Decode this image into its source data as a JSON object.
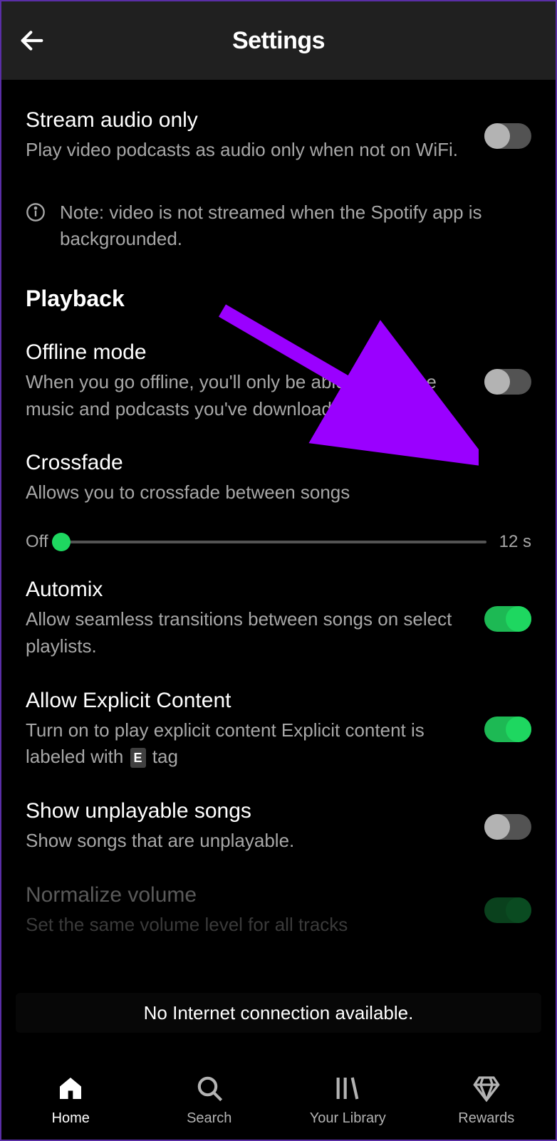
{
  "header": {
    "title": "Settings"
  },
  "settings": {
    "stream_audio": {
      "title": "Stream audio only",
      "desc": "Play video podcasts as audio only when not on WiFi.",
      "value": false
    },
    "info_note": "Note: video is not streamed when the Spotify app is backgrounded.",
    "playback_header": "Playback",
    "offline_mode": {
      "title": "Offline mode",
      "desc": "When you go offline, you'll only be able to play the music and podcasts you've downloaded.",
      "value": false
    },
    "crossfade": {
      "title": "Crossfade",
      "desc": "Allows you to crossfade between songs",
      "min_label": "Off",
      "max_label": "12 s",
      "value": 0
    },
    "automix": {
      "title": "Automix",
      "desc": "Allow seamless transitions between songs on select playlists.",
      "value": true
    },
    "explicit": {
      "title": "Allow Explicit Content",
      "desc_before": "Turn on to play explicit content Explicit content is labeled with ",
      "desc_tag": "E",
      "desc_after": " tag",
      "value": true
    },
    "unplayable": {
      "title": "Show unplayable songs",
      "desc": "Show songs that are unplayable.",
      "value": false
    },
    "normalize": {
      "title": "Normalize volume",
      "desc": "Set the same volume level for all tracks",
      "value": true
    }
  },
  "toast": "No Internet connection available.",
  "nav": {
    "home": "Home",
    "search": "Search",
    "library": "Your Library",
    "rewards": "Rewards"
  },
  "colors": {
    "accent": "#1ed760",
    "arrow": "#9a00ff"
  }
}
